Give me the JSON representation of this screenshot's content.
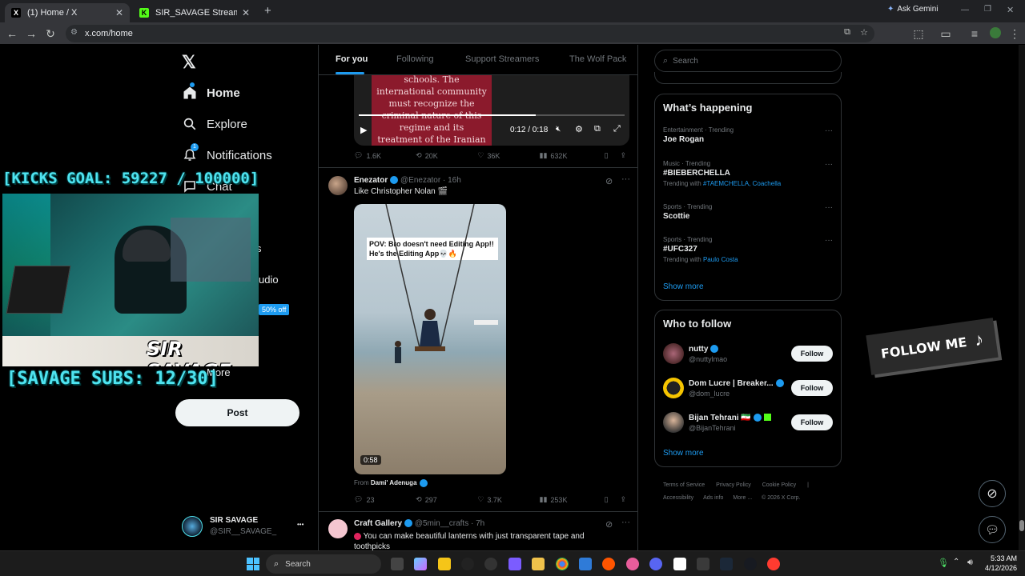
{
  "browser": {
    "tabs": [
      {
        "title": "(1) Home / X",
        "favicon": "X",
        "close": "✕"
      },
      {
        "title": "SIR_SAVAGE Stream - Watch Li",
        "favicon": "K",
        "close": "✕"
      }
    ],
    "new_tab": "+",
    "ask_gemini": "Ask Gemini",
    "url": "x.com/home"
  },
  "nav": {
    "items": [
      {
        "label": "Home",
        "icon": "home-icon"
      },
      {
        "label": "Explore",
        "icon": "search-icon"
      },
      {
        "label": "Notifications",
        "icon": "bell-icon",
        "badge": "1"
      },
      {
        "label": "Chat",
        "icon": "chat-icon"
      }
    ],
    "partial_labels": [
      "s",
      "udio",
      "More"
    ],
    "post_button": "Post",
    "account": {
      "name": "SIR SAVAGE",
      "handle": "@SIR__SAVAGE_",
      "more": "•••"
    }
  },
  "feed": {
    "tabs": [
      "For you",
      "Following",
      "Support Streamers",
      "The Wolf Pack"
    ],
    "post1": {
      "video_text": "schools. The international community must recognize the criminal nature of this regime and its treatment of the Iranian people, who are effectively held hostage.",
      "time": "0:12 / 0:18",
      "replies": "1.6K",
      "reposts": "20K",
      "likes": "36K",
      "views": "632K"
    },
    "post2": {
      "name": "Enezator",
      "handle": "@Enezator",
      "time": "· 16h",
      "text": "Like Christopher Nolan 🎬",
      "video_caption": "POV: Bro doesn't need Editing App!! He's the Editing App💀🔥",
      "duration": "0:58",
      "from_label": "From",
      "from_name": "Dami' Adenuga",
      "replies": "23",
      "reposts": "297",
      "likes": "3.7K",
      "views": "253K"
    },
    "post3": {
      "name": "Craft Gallery",
      "handle": "@5min__crafts",
      "time": "· 7h",
      "text": "You can make beautiful lanterns with just transparent tape and toothpicks"
    }
  },
  "right": {
    "search_placeholder": "Search",
    "happening": {
      "title": "What’s happening",
      "trends": [
        {
          "category": "Entertainment · Trending",
          "name": "Joe Rogan",
          "sub": "",
          "links": ""
        },
        {
          "category": "Music · Trending",
          "name": "#BIEBERCHELLA",
          "sub": "Trending with",
          "links": "#TAEMCHELLA, Coachella"
        },
        {
          "category": "Sports · Trending",
          "name": "Scottie",
          "sub": "",
          "links": ""
        },
        {
          "category": "Sports · Trending",
          "name": "#UFC327",
          "sub": "Trending with",
          "links": "Paulo Costa"
        }
      ],
      "show_more": "Show more"
    },
    "who_to_follow": {
      "title": "Who to follow",
      "people": [
        {
          "name": "nutty",
          "handle": "@nuttylmao",
          "button": "Follow"
        },
        {
          "name": "Dom Lucre | Breaker...",
          "handle": "@dom_lucre",
          "button": "Follow"
        },
        {
          "name": "Bijan Tehrani 🇮🇷",
          "handle": "@BijanTehrani",
          "button": "Follow"
        }
      ],
      "show_more": "Show more"
    },
    "footer": {
      "line1": [
        "Terms of Service",
        "Privacy Policy",
        "Cookie Policy",
        "|"
      ],
      "line2": [
        "Accessibility",
        "Ads info",
        "More ...",
        "© 2026 X Corp."
      ]
    }
  },
  "overlay": {
    "kicks_goal": "[KICKS GOAL: 59227 / 100000]",
    "subs_goal": "[SAVAGE SUBS: 12/30]",
    "streamer_logo": "SIR SAVAGE",
    "discount": "50% off",
    "follow_me": "FOLLOW ME"
  },
  "taskbar": {
    "search": "Search",
    "time": "5:33 AM",
    "date": "4/12/2026"
  },
  "colors": {
    "accent": "#1d9bf0",
    "hud": "#4fe3ef",
    "bg": "#000000"
  }
}
